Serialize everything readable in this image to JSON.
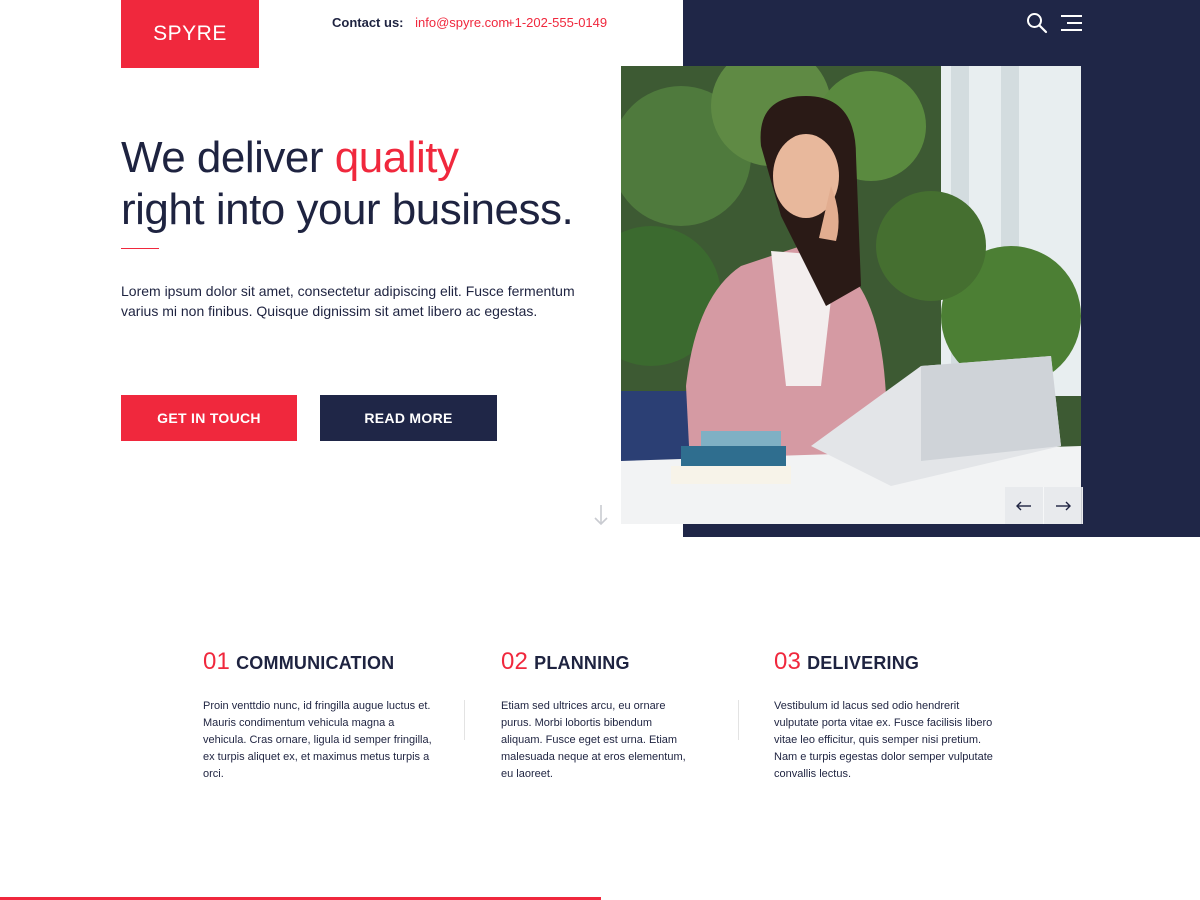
{
  "brand": {
    "logo_text": "SPYRE",
    "accent_color": "#f0283d",
    "navy_color": "#1f2647"
  },
  "header": {
    "contact_label": "Contact us:",
    "email": "info@spyre.com",
    "phone": "+1-202-555-0149",
    "icons": [
      "search-icon",
      "menu-icon"
    ]
  },
  "hero": {
    "headline_line1_prefix": "We deliver ",
    "headline_accent": "quality",
    "headline_line2": "right into your business.",
    "lead": "Lorem ipsum dolor sit amet, consectetur adipiscing elit. Fusce fermentum varius mi non finibus. Quisque dignissim sit amet libero ac egestas.",
    "cta_primary": "GET IN TOUCH",
    "cta_secondary": "READ MORE",
    "scroll_icon": "arrow-down-icon",
    "slider_prev_icon": "arrow-left-icon",
    "slider_next_icon": "arrow-right-icon"
  },
  "features": [
    {
      "number": "01",
      "title": "COMMUNICATION",
      "text": "Proin venttdio nunc, id fringilla augue luctus et. Mauris condimentum vehicula magna a vehicula. Cras ornare, ligula id semper fringilla, ex turpis aliquet ex, et maximus metus turpis a orci."
    },
    {
      "number": "02",
      "title": "PLANNING",
      "text": "Etiam sed ultrices arcu, eu ornare purus. Morbi lobortis bibendum aliquam. Fusce eget est urna. Etiam malesuada neque at eros elementum, eu laoreet."
    },
    {
      "number": "03",
      "title": "DELIVERING",
      "text": "Vestibulum id lacus sed odio hendrerit vulputate porta vitae ex. Fusce facilisis libero vitae leo efficitur, quis semper nisi pretium. Nam e turpis egestas dolor semper vulputate convallis lectus."
    }
  ]
}
